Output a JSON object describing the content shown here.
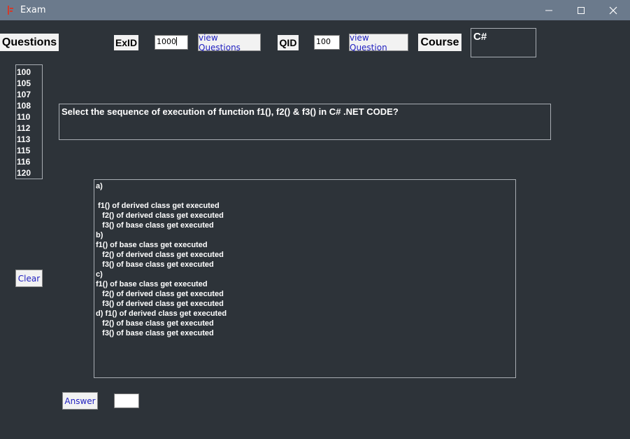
{
  "window": {
    "title": "Exam",
    "controls": {
      "minimize": "—",
      "maximize": "☐",
      "close": "✕"
    }
  },
  "header": {
    "questions_label": "Questions",
    "exid_label": "ExID",
    "exid_value": "1000",
    "view_questions_label": "view Questions",
    "qid_label": "QID",
    "qid_value": "100",
    "view_question_label": "view Question",
    "course_label": "Course",
    "course_value": "C#"
  },
  "question_list": [
    "100",
    "105",
    "107",
    "108",
    "110",
    "112",
    "113",
    "115",
    "116",
    "120"
  ],
  "question_text": "Select the sequence of execution of function f1(), f2() & f3() in C# .NET CODE?",
  "answers": {
    "lines": [
      "a)",
      "",
      " f1() of derived class get executed",
      "   f2() of derived class get executed",
      "   f3() of base class get executed",
      "b)",
      "f1() of base class get executed",
      "   f2() of derived class get executed",
      "   f3() of base class get executed",
      "c)",
      "f1() of base class get executed",
      "   f2() of derived class get executed",
      "   f3() of derived class get executed",
      "d) f1() of derived class get executed",
      "   f2() of base class get executed",
      "   f3() of base class get executed"
    ]
  },
  "buttons": {
    "clear_label": "Clear",
    "answer_label": "Answer"
  },
  "answer_input_value": ""
}
